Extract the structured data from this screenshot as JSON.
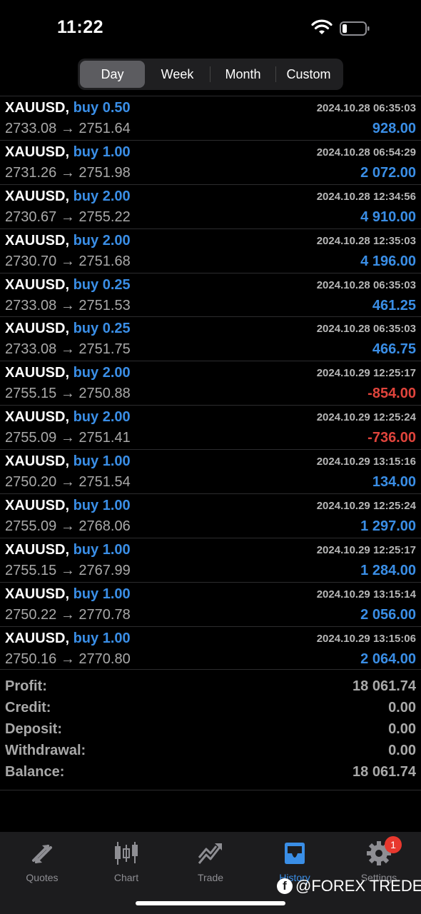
{
  "status_bar": {
    "time": "11:22"
  },
  "period_tabs": [
    {
      "label": "Day",
      "active": true
    },
    {
      "label": "Week",
      "active": false
    },
    {
      "label": "Month",
      "active": false
    },
    {
      "label": "Custom",
      "active": false
    }
  ],
  "deals": [
    {
      "symbol": "XAUUSD,",
      "side": "buy 0.50",
      "time": "2024.10.28 06:35:03",
      "prices": "2733.08 → 2751.64",
      "profit": "928.00",
      "negative": false
    },
    {
      "symbol": "XAUUSD,",
      "side": "buy 1.00",
      "time": "2024.10.28 06:54:29",
      "prices": "2731.26 → 2751.98",
      "profit": "2 072.00",
      "negative": false
    },
    {
      "symbol": "XAUUSD,",
      "side": "buy 2.00",
      "time": "2024.10.28 12:34:56",
      "prices": "2730.67 → 2755.22",
      "profit": "4 910.00",
      "negative": false
    },
    {
      "symbol": "XAUUSD,",
      "side": "buy 2.00",
      "time": "2024.10.28 12:35:03",
      "prices": "2730.70 → 2751.68",
      "profit": "4 196.00",
      "negative": false
    },
    {
      "symbol": "XAUUSD,",
      "side": "buy 0.25",
      "time": "2024.10.28 06:35:03",
      "prices": "2733.08 → 2751.53",
      "profit": "461.25",
      "negative": false
    },
    {
      "symbol": "XAUUSD,",
      "side": "buy 0.25",
      "time": "2024.10.28 06:35:03",
      "prices": "2733.08 → 2751.75",
      "profit": "466.75",
      "negative": false
    },
    {
      "symbol": "XAUUSD,",
      "side": "buy 2.00",
      "time": "2024.10.29 12:25:17",
      "prices": "2755.15 → 2750.88",
      "profit": "-854.00",
      "negative": true
    },
    {
      "symbol": "XAUUSD,",
      "side": "buy 2.00",
      "time": "2024.10.29 12:25:24",
      "prices": "2755.09 → 2751.41",
      "profit": "-736.00",
      "negative": true
    },
    {
      "symbol": "XAUUSD,",
      "side": "buy 1.00",
      "time": "2024.10.29 13:15:16",
      "prices": "2750.20 → 2751.54",
      "profit": "134.00",
      "negative": false
    },
    {
      "symbol": "XAUUSD,",
      "side": "buy 1.00",
      "time": "2024.10.29 12:25:24",
      "prices": "2755.09 → 2768.06",
      "profit": "1 297.00",
      "negative": false
    },
    {
      "symbol": "XAUUSD,",
      "side": "buy 1.00",
      "time": "2024.10.29 12:25:17",
      "prices": "2755.15 → 2767.99",
      "profit": "1 284.00",
      "negative": false
    },
    {
      "symbol": "XAUUSD,",
      "side": "buy 1.00",
      "time": "2024.10.29 13:15:14",
      "prices": "2750.22 → 2770.78",
      "profit": "2 056.00",
      "negative": false
    },
    {
      "symbol": "XAUUSD,",
      "side": "buy 1.00",
      "time": "2024.10.29 13:15:06",
      "prices": "2750.16 → 2770.80",
      "profit": "2 064.00",
      "negative": false
    }
  ],
  "summary": [
    {
      "label": "Profit:",
      "value": "18 061.74"
    },
    {
      "label": "Credit:",
      "value": "0.00"
    },
    {
      "label": "Deposit:",
      "value": "0.00"
    },
    {
      "label": "Withdrawal:",
      "value": "0.00"
    },
    {
      "label": "Balance:",
      "value": "18 061.74"
    }
  ],
  "tab_bar": [
    {
      "label": "Quotes",
      "icon": "quotes-icon",
      "active": false
    },
    {
      "label": "Chart",
      "icon": "chart-icon",
      "active": false
    },
    {
      "label": "Trade",
      "icon": "trade-icon",
      "active": false
    },
    {
      "label": "History",
      "icon": "history-icon",
      "active": true
    },
    {
      "label": "Settings",
      "icon": "settings-icon",
      "active": false,
      "badge": "1"
    }
  ],
  "watermark": "@FOREX TREDER",
  "colors": {
    "accent": "#3a8ee6",
    "loss": "#e0443c",
    "background": "#000000"
  }
}
